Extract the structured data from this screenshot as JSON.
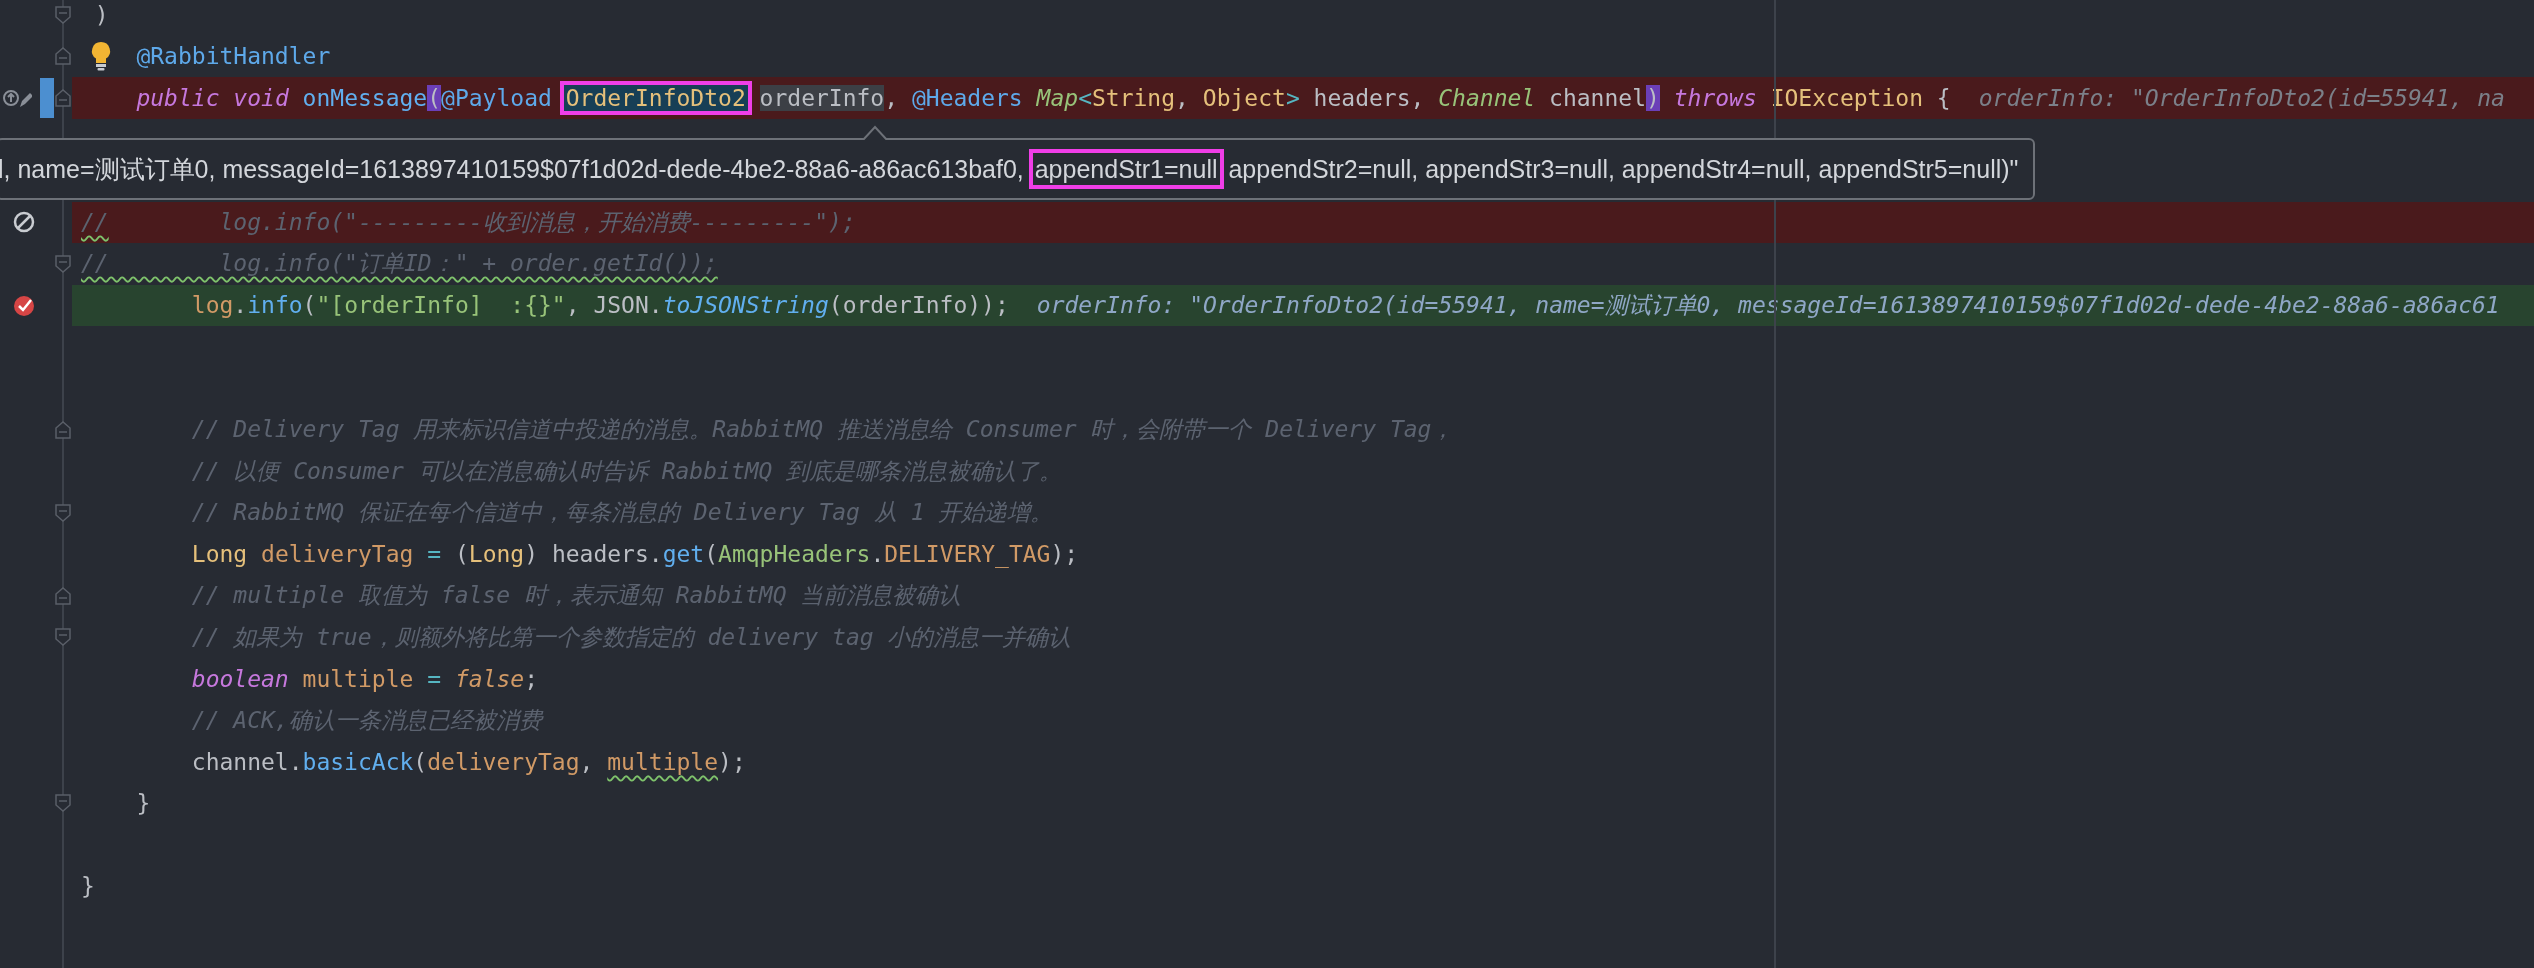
{
  "editor": {
    "lines": [
      {
        "kind": "code",
        "fold": {
          "kind": "end"
        },
        "tokens": [
          {
            "text": " )",
            "kind": "plain"
          }
        ]
      },
      {
        "kind": "code",
        "fold": {
          "kind": "start"
        },
        "gutter_icons": [
          {
            "kind": "bulb"
          }
        ],
        "tokens": [
          {
            "text": "    @RabbitHandler",
            "kind": "annotation"
          }
        ]
      },
      {
        "kind": "code",
        "breakpoint": true,
        "fold": {
          "kind": "start"
        },
        "gutter_icons": [
          {
            "kind": "override"
          },
          {
            "kind": "marker"
          }
        ],
        "tokens": [
          {
            "text": "    public",
            "kind": "keyword"
          },
          {
            "text": " void",
            "kind": "keyword"
          },
          {
            "text": " onMessage",
            "kind": "function"
          },
          {
            "text": "(",
            "kind": "plain",
            "bracket_match": true
          },
          {
            "text": "@Payload",
            "kind": "annotation"
          },
          {
            "text": " OrderInfoDto2",
            "kind": "type",
            "selected": true,
            "boxed": true
          },
          {
            "text": " orderInfo",
            "kind": "plain",
            "usage": true
          },
          {
            "text": ",",
            "kind": "plain"
          },
          {
            "text": " @Headers",
            "kind": "annotation"
          },
          {
            "text": " Map",
            "kind": "interface"
          },
          {
            "text": "<",
            "kind": "operator"
          },
          {
            "text": "String",
            "kind": "type"
          },
          {
            "text": ",",
            "kind": "plain"
          },
          {
            "text": " Object",
            "kind": "type"
          },
          {
            "text": ">",
            "kind": "operator"
          },
          {
            "text": " headers,",
            "kind": "plain"
          },
          {
            "text": " Channel",
            "kind": "interface"
          },
          {
            "text": " channel",
            "kind": "plain"
          },
          {
            "text": ")",
            "kind": "plain",
            "bracket_match": true
          },
          {
            "text": " throws",
            "kind": "keyword"
          },
          {
            "text": " IOException",
            "kind": "type"
          },
          {
            "text": " {",
            "kind": "plain"
          },
          {
            "text": "orderInfo: \"OrderInfoDto2(id=55941, na",
            "kind": "debug"
          }
        ]
      },
      {
        "kind": "blank"
      },
      {
        "kind": "blank"
      },
      {
        "kind": "code",
        "breakpoint": true,
        "gutter_icons": [
          {
            "kind": "disabled-breakpoint"
          }
        ],
        "tokens": [
          {
            "text": "//",
            "kind": "comment",
            "squiggle": true
          },
          {
            "text": "        log.info(\"---------收到消息，开始消费---------\");",
            "kind": "comment"
          }
        ]
      },
      {
        "kind": "code",
        "fold": {
          "kind": "end"
        },
        "tokens": [
          {
            "text": "//        log.info(\"订单ID：\" + order.getId());",
            "kind": "comment",
            "squiggle": true
          }
        ]
      },
      {
        "kind": "code",
        "current": true,
        "gutter_icons": [
          {
            "kind": "breakpoint-hit"
          }
        ],
        "tokens": [
          {
            "text": "        log",
            "kind": "field"
          },
          {
            "text": ".",
            "kind": "plain"
          },
          {
            "text": "info",
            "kind": "function"
          },
          {
            "text": "(",
            "kind": "plain"
          },
          {
            "text": "\"[orderInfo]  :{}\"",
            "kind": "string"
          },
          {
            "text": ", JSON.",
            "kind": "plain"
          },
          {
            "text": "toJSONString",
            "kind": "static-method"
          },
          {
            "text": "(orderInfo));",
            "kind": "plain"
          },
          {
            "text": "orderInfo: \"OrderInfoDto2(id=55941, name=测试订单0, messageId=1613897410159$07f1d02d-dede-4be2-88a6-a86ac61",
            "kind": "debug"
          }
        ]
      },
      {
        "kind": "blank"
      },
      {
        "kind": "blank"
      },
      {
        "kind": "code",
        "fold": {
          "kind": "start"
        },
        "tokens": [
          {
            "text": "        // Delivery Tag 用来标识信道中投递的消息。RabbitMQ 推送消息给 Consumer 时，会附带一个 Delivery Tag，",
            "kind": "comment"
          }
        ]
      },
      {
        "kind": "code",
        "tokens": [
          {
            "text": "        // 以便 Consumer 可以在消息确认时告诉 RabbitMQ 到底是哪条消息被确认了。",
            "kind": "comment"
          }
        ]
      },
      {
        "kind": "code",
        "fold": {
          "kind": "end"
        },
        "tokens": [
          {
            "text": "        // RabbitMQ 保证在每个信道中，每条消息的 Delivery Tag 从 1 开始递增。",
            "kind": "comment"
          }
        ]
      },
      {
        "kind": "code",
        "tokens": [
          {
            "text": "        Long",
            "kind": "type"
          },
          {
            "text": " deliveryTag",
            "kind": "local"
          },
          {
            "text": " =",
            "kind": "operator"
          },
          {
            "text": " (",
            "kind": "plain"
          },
          {
            "text": "Long",
            "kind": "type"
          },
          {
            "text": ") headers.",
            "kind": "plain"
          },
          {
            "text": "get",
            "kind": "function"
          },
          {
            "text": "(",
            "kind": "plain"
          },
          {
            "text": "AmqpHeaders",
            "kind": "class-ref"
          },
          {
            "text": ".",
            "kind": "plain"
          },
          {
            "text": "DELIVERY_TAG",
            "kind": "constant"
          },
          {
            "text": ");",
            "kind": "plain"
          }
        ]
      },
      {
        "kind": "code",
        "fold": {
          "kind": "start"
        },
        "tokens": [
          {
            "text": "        // multiple 取值为 false 时，表示通知 RabbitMQ 当前消息被确认",
            "kind": "comment"
          }
        ]
      },
      {
        "kind": "code",
        "fold": {
          "kind": "end"
        },
        "tokens": [
          {
            "text": "        // 如果为 true，则额外将比第一个参数指定的 delivery tag 小的消息一并确认",
            "kind": "comment"
          }
        ]
      },
      {
        "kind": "code",
        "tokens": [
          {
            "text": "        boolean",
            "kind": "keyword"
          },
          {
            "text": " multiple",
            "kind": "local"
          },
          {
            "text": " =",
            "kind": "operator"
          },
          {
            "text": " false",
            "kind": "literal"
          },
          {
            "text": ";",
            "kind": "plain"
          }
        ]
      },
      {
        "kind": "code",
        "tokens": [
          {
            "text": "        // ACK,确认一条消息已经被消费",
            "kind": "comment"
          }
        ]
      },
      {
        "kind": "code",
        "tokens": [
          {
            "text": "        channel.",
            "kind": "plain"
          },
          {
            "text": "basicAck",
            "kind": "function"
          },
          {
            "text": "(",
            "kind": "plain"
          },
          {
            "text": "deliveryTag",
            "kind": "local"
          },
          {
            "text": ",",
            "kind": "plain"
          },
          {
            "text": " multiple",
            "kind": "local",
            "squiggle": true
          },
          {
            "text": ");",
            "kind": "plain"
          }
        ]
      },
      {
        "kind": "code",
        "fold": {
          "kind": "end"
        },
        "tokens": [
          {
            "text": "    }",
            "kind": "plain"
          }
        ]
      },
      {
        "kind": "blank"
      },
      {
        "kind": "code",
        "tokens": [
          {
            "text": "}",
            "kind": "plain"
          }
        ]
      }
    ]
  },
  "tooltip": {
    "segments": [
      {
        "text": "l, name=测试订单0, messageId=1613897410159$07f1d02d-dede-4be2-88a6-a86ac613baf0, ",
        "boxed": false
      },
      {
        "text": "appendStr1=null",
        "boxed": true
      },
      {
        "text": " appendStr2=null, appendStr3=null, appendStr4=null, appendStr5=null)\"",
        "boxed": false
      }
    ]
  }
}
